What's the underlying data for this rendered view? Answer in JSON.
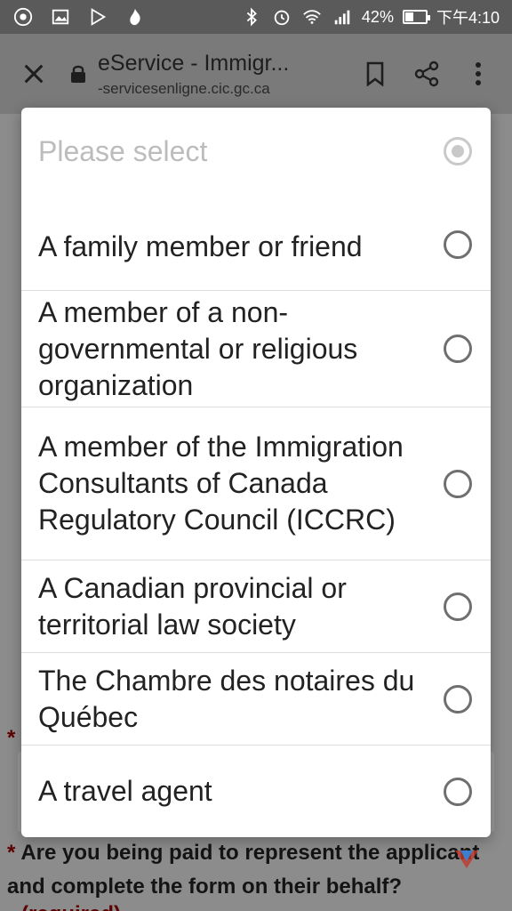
{
  "status_bar": {
    "battery": "42%",
    "battery_level": 0.42,
    "time": "下午4:10"
  },
  "toolbar": {
    "title": "eService - Immigr...",
    "url": "-servicesenligne.cic.gc.ca"
  },
  "background": {
    "asterisk": "*",
    "question": "Are you being paid to represent the applicant and complete the form on their behalf?",
    "required_note": "(required)"
  },
  "dialog": {
    "placeholder": "Please select",
    "options": [
      {
        "label": "A family member or friend"
      },
      {
        "label": "A member of a non-governmental or religious organization"
      },
      {
        "label": "A member of the Immigration Consultants of Canada Regulatory Council (ICCRC)"
      },
      {
        "label": "A Canadian provincial or territorial law society"
      },
      {
        "label": "The Chambre des notaires du Québec"
      },
      {
        "label": "A travel agent"
      }
    ]
  }
}
